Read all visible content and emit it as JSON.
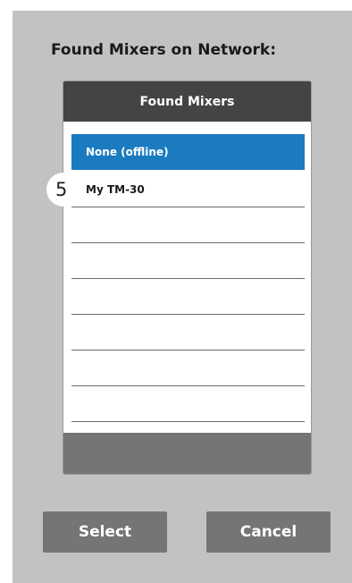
{
  "heading": "Found Mixers on Network:",
  "panel": {
    "title": "Found Mixers",
    "items": [
      {
        "label": "None (offline)",
        "selected": true
      },
      {
        "label": "My TM-30",
        "selected": false
      },
      {
        "label": "",
        "selected": false
      },
      {
        "label": "",
        "selected": false
      },
      {
        "label": "",
        "selected": false
      },
      {
        "label": "",
        "selected": false
      },
      {
        "label": "",
        "selected": false
      },
      {
        "label": "",
        "selected": false
      }
    ]
  },
  "badge": "5",
  "buttons": {
    "select_label": "Select",
    "cancel_label": "Cancel"
  },
  "colors": {
    "dialog_bg": "#c2c2c2",
    "header_bg": "#444444",
    "selected_row": "#1b7bc0",
    "button_bg": "#757575"
  }
}
